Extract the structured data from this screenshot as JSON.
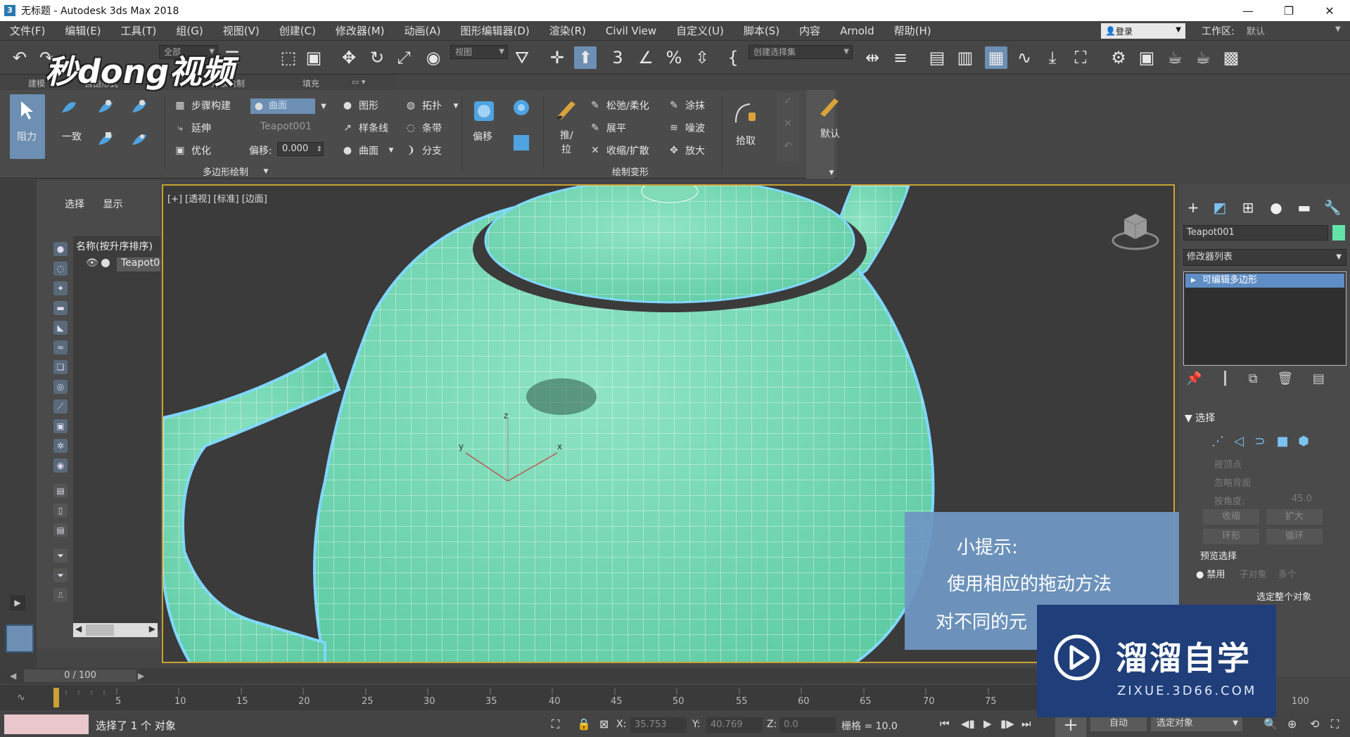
{
  "window": {
    "title": "无标题 - Autodesk 3ds Max 2018",
    "minimize": "—",
    "restore": "❐",
    "close": "✕"
  },
  "menu": [
    "文件(F)",
    "编辑(E)",
    "工具(T)",
    "组(G)",
    "视图(V)",
    "创建(C)",
    "修改器(M)",
    "动画(A)",
    "图形编辑器(D)",
    "渲染(R)",
    "Civil View",
    "自定义(U)",
    "脚本(S)",
    "内容",
    "Arnold",
    "帮助(H)"
  ],
  "login": "登录",
  "workspace": {
    "label": "工作区:",
    "value": "默认"
  },
  "toolbar": {
    "selection_filter": "全部",
    "ref_coord": "视图",
    "named_selection": "创建选择集"
  },
  "ribbon_tabs": [
    "建模",
    "自由形式",
    "选择",
    "对象绘制",
    "填充"
  ],
  "ribbon": {
    "resist": "阻力",
    "consistent": "一致",
    "step_build": "步骤构建",
    "extend": "延伸",
    "optimize": "优化",
    "curve_drop": "曲面",
    "target_object": "Teapot001",
    "offset_label": "偏移:",
    "offset_value": "0.000",
    "shapes": "图形",
    "spline": "样条线",
    "surface": "曲面",
    "topology": "拓扑",
    "strips": "条带",
    "branches": "分支",
    "polydraw_group": "多边形绘制",
    "offset_btn": "偏移",
    "push_pull_1": "推/",
    "push_pull_2": "拉",
    "relax": "松弛/柔化",
    "flatten": "展平",
    "pinch_spread": "收缩/扩散",
    "smudge": "涂抹",
    "noise": "噪波",
    "exaggerate": "放大",
    "paint_deform_group": "绘制变形",
    "pick": "拾取",
    "default": "默认"
  },
  "watermark": {
    "top": "秒dong视频",
    "brand": "溜溜自学",
    "url": "ZIXUE.3D66.COM"
  },
  "scene_explorer": {
    "tab_select": "选择",
    "tab_display": "显示",
    "header": "名称(按升序排序)",
    "row": "Teapot0"
  },
  "viewport": {
    "label": "[+] [透视] [标准] [边面]",
    "axis_x": "x",
    "axis_y": "y",
    "axis_z": "z"
  },
  "tip": {
    "title": "小提示:",
    "line1": "使用相应的拖动方法",
    "line2": "对不同的元"
  },
  "command_panel": {
    "object_name": "Teapot001",
    "object_color": "#64e3a8",
    "modifier_list": "修改器列表",
    "stack_item": "可编辑多边形",
    "selection_rollout": "选择",
    "by_vertex": "按顶点",
    "ignore_backface": "忽略背面",
    "by_angle": "按角度:",
    "angle_value": "45.0",
    "shrink": "收缩",
    "grow": "扩大",
    "ring": "环形",
    "loop": "循环",
    "preview_selection": "预览选择",
    "disabled": "禁用",
    "sub_object": "子对象",
    "multi": "多个",
    "select_whole": "选定整个对象"
  },
  "timeline": {
    "position": "0 / 100",
    "ticks": [
      "5",
      "10",
      "15",
      "20",
      "25",
      "30",
      "35",
      "40",
      "45",
      "50",
      "55",
      "60",
      "65",
      "70",
      "75",
      "100"
    ]
  },
  "status": {
    "message": "选择了 1 个 对象",
    "x_label": "X:",
    "x_value": "35.753",
    "y_label": "Y:",
    "y_value": "40.769",
    "z_label": "Z:",
    "z_value": "0.0",
    "grid": "栅格 = 10.0",
    "add_key": "+",
    "auto": "自动",
    "selected_object": "选定对象"
  }
}
